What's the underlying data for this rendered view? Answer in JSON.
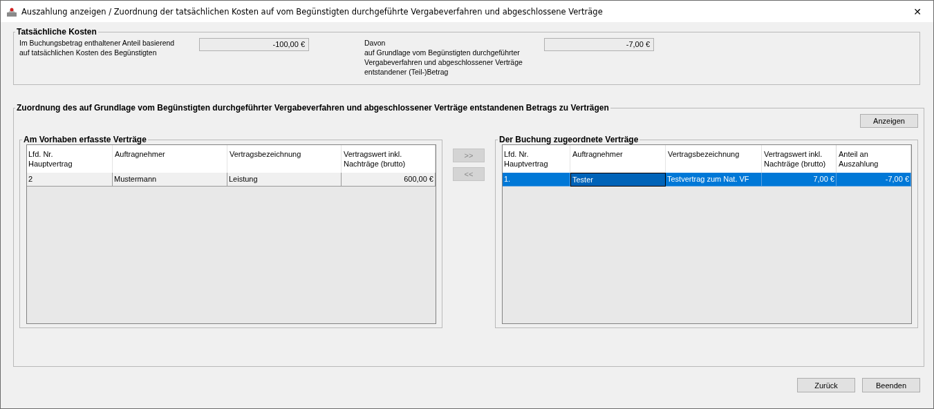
{
  "window": {
    "title": "Auszahlung anzeigen / Zuordnung der tatsächlichen Kosten auf vom Begünstigten durchgeführte Vergabeverfahren und abgeschlossene Verträge",
    "close": "✕"
  },
  "actual_costs": {
    "title": "Tatsächliche Kosten",
    "fields": [
      {
        "label": "Im Buchungsbetrag enthaltener Anteil basierend\nauf tatsächlichen Kosten des Begünstigten",
        "value": "-100,00 €"
      },
      {
        "label": "Davon\nauf Grundlage vom Begünstigten durchgeführter\nVergabeverfahren und abgeschlossener Verträge\nentstandener (Teil-)Betrag",
        "value": "-7,00 €"
      }
    ]
  },
  "assignment": {
    "title": "Zuordnung des auf Grundlage vom Begünstigten durchgeführter Vergabeverfahren und abgeschlossener Verträge entstandenen Betrags zu Verträgen",
    "show_button": {
      "label": "Anzeigen",
      "disabled": false
    },
    "move_buttons": [
      {
        "label": ">>",
        "disabled": true
      },
      {
        "label": "<<",
        "disabled": true
      }
    ],
    "tables": [
      {
        "title": "Am Vorhaben erfasste Verträge",
        "columns": [
          {
            "label": "Lfd. Nr.\nHauptvertrag",
            "numeric": false
          },
          {
            "label": "Auftragnehmer",
            "numeric": false
          },
          {
            "label": "Vertragsbezeichnung",
            "numeric": false
          },
          {
            "label": "Vertragswert inkl.\nNachträge (brutto)",
            "numeric": true
          }
        ],
        "rows": [
          {
            "selected": false,
            "cells": [
              {
                "text": "2",
                "focused": false
              },
              {
                "text": "Mustermann",
                "focused": false
              },
              {
                "text": "Leistung",
                "focused": false
              },
              {
                "text": "600,00 €",
                "focused": false
              }
            ]
          }
        ]
      },
      {
        "title": "Der Buchung zugeordnete Verträge",
        "columns": [
          {
            "label": "Lfd. Nr.\nHauptvertrag",
            "numeric": false
          },
          {
            "label": "Auftragnehmer",
            "numeric": false
          },
          {
            "label": "Vertragsbezeichnung",
            "numeric": false
          },
          {
            "label": "Vertragswert inkl.\nNachträge (brutto)",
            "numeric": true
          },
          {
            "label": "Anteil an\nAuszahlung",
            "numeric": true
          }
        ],
        "rows": [
          {
            "selected": true,
            "cells": [
              {
                "text": "1.",
                "focused": false
              },
              {
                "text": "Tester",
                "focused": true
              },
              {
                "text": "Testvertrag zum Nat. VF",
                "focused": false
              },
              {
                "text": "7,00 €",
                "focused": false
              },
              {
                "text": "-7,00 €",
                "focused": false
              }
            ]
          }
        ]
      }
    ]
  },
  "footer_buttons": [
    {
      "label": "Zurück",
      "disabled": false
    },
    {
      "label": "Beenden",
      "disabled": false
    }
  ]
}
